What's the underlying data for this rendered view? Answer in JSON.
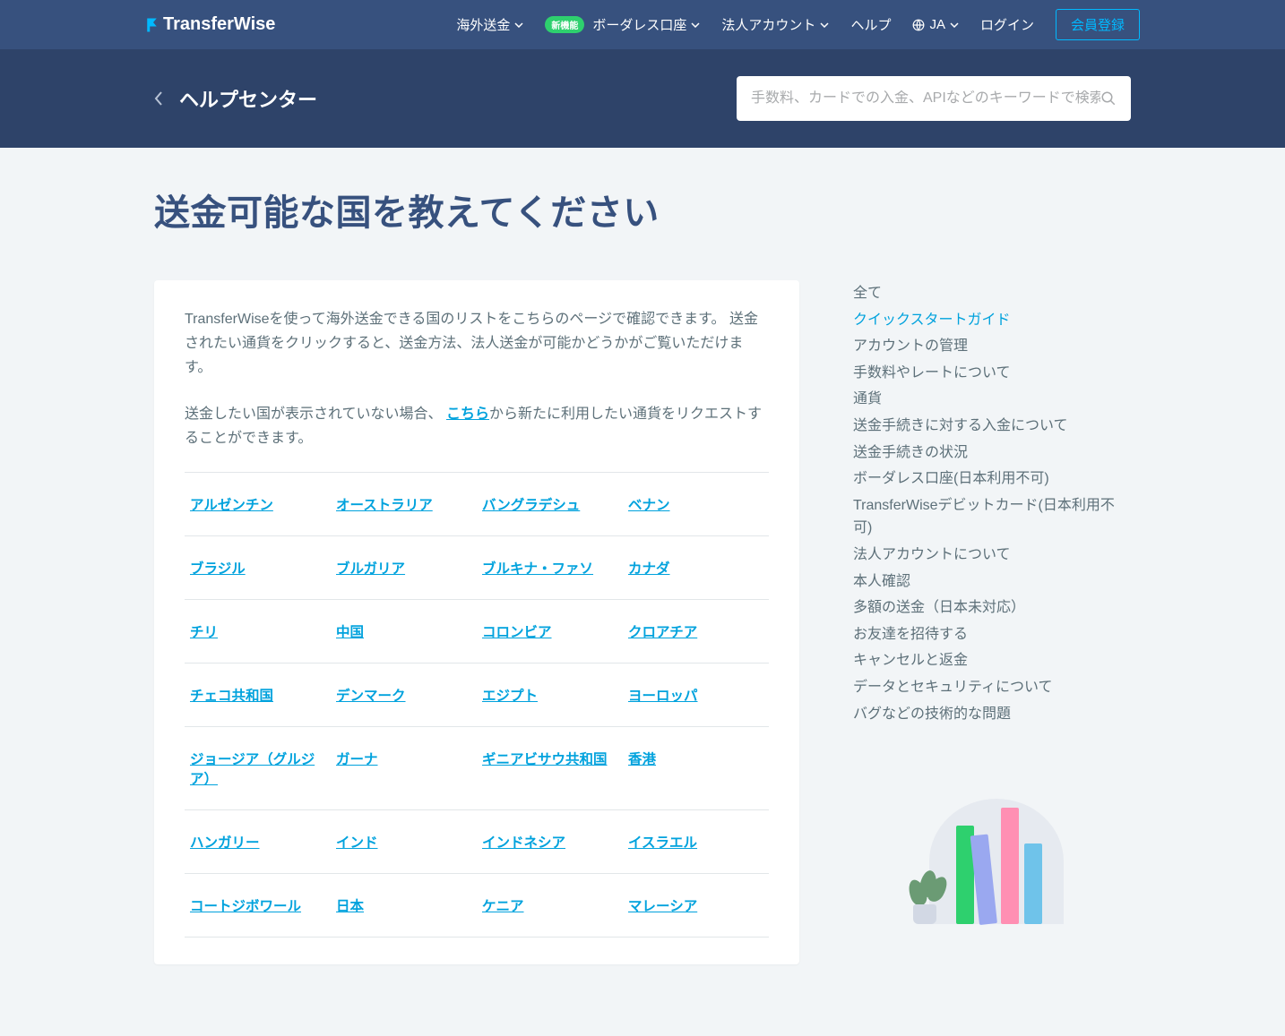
{
  "brand": "TransferWise",
  "nav": {
    "send": "海外送金",
    "new_badge": "新機能",
    "borderless": "ボーダレス口座",
    "business": "法人アカウント",
    "help": "ヘルプ",
    "lang": "JA",
    "login": "ログイン",
    "signup": "会員登録"
  },
  "subbar": {
    "help_center": "ヘルプセンター",
    "search_placeholder": "手数料、カードでの入金、APIなどのキーワードで検索"
  },
  "page": {
    "title": "送金可能な国を教えてください",
    "intro1": "TransferWiseを使って海外送金できる国のリストをこちらのページで確認できます。 送金されたい通貨をクリックすると、送金方法、法人送金が可能かどうかがご覧いただけます。",
    "intro2a": "送金したい国が表示されていない場合、 ",
    "intro2_link": "こちら",
    "intro2b": "から新たに利用したい通貨をリクエストすることができます。"
  },
  "countries": [
    [
      "アルゼンチン",
      "オーストラリア",
      "バングラデシュ",
      "ベナン"
    ],
    [
      "ブラジル",
      "ブルガリア",
      "ブルキナ・ファソ",
      "カナダ"
    ],
    [
      "チリ",
      "中国",
      "コロンビア",
      "クロアチア"
    ],
    [
      "チェコ共和国",
      "デンマーク",
      "エジプト",
      "ヨーロッパ"
    ],
    [
      "ジョージア（グルジア）",
      "ガーナ",
      "ギニアビサウ共和国",
      "香港"
    ],
    [
      "ハンガリー",
      "インド",
      "インドネシア",
      "イスラエル"
    ],
    [
      "コートジボワール",
      "日本",
      "ケニア",
      "マレーシア"
    ]
  ],
  "sidebar": {
    "items": [
      "全て",
      "クイックスタートガイド",
      "アカウントの管理",
      "手数料やレートについて",
      "通貨",
      "送金手続きに対する入金について",
      "送金手続きの状況",
      "ボーダレス口座(日本利用不可)",
      "TransferWiseデビットカード(日本利用不可)",
      "法人アカウントについて",
      "本人確認",
      "多額の送金（日本未対応）",
      "お友達を招待する",
      "キャンセルと返金",
      "データとセキュリティについて",
      "バグなどの技術的な問題"
    ],
    "active_index": 1
  }
}
